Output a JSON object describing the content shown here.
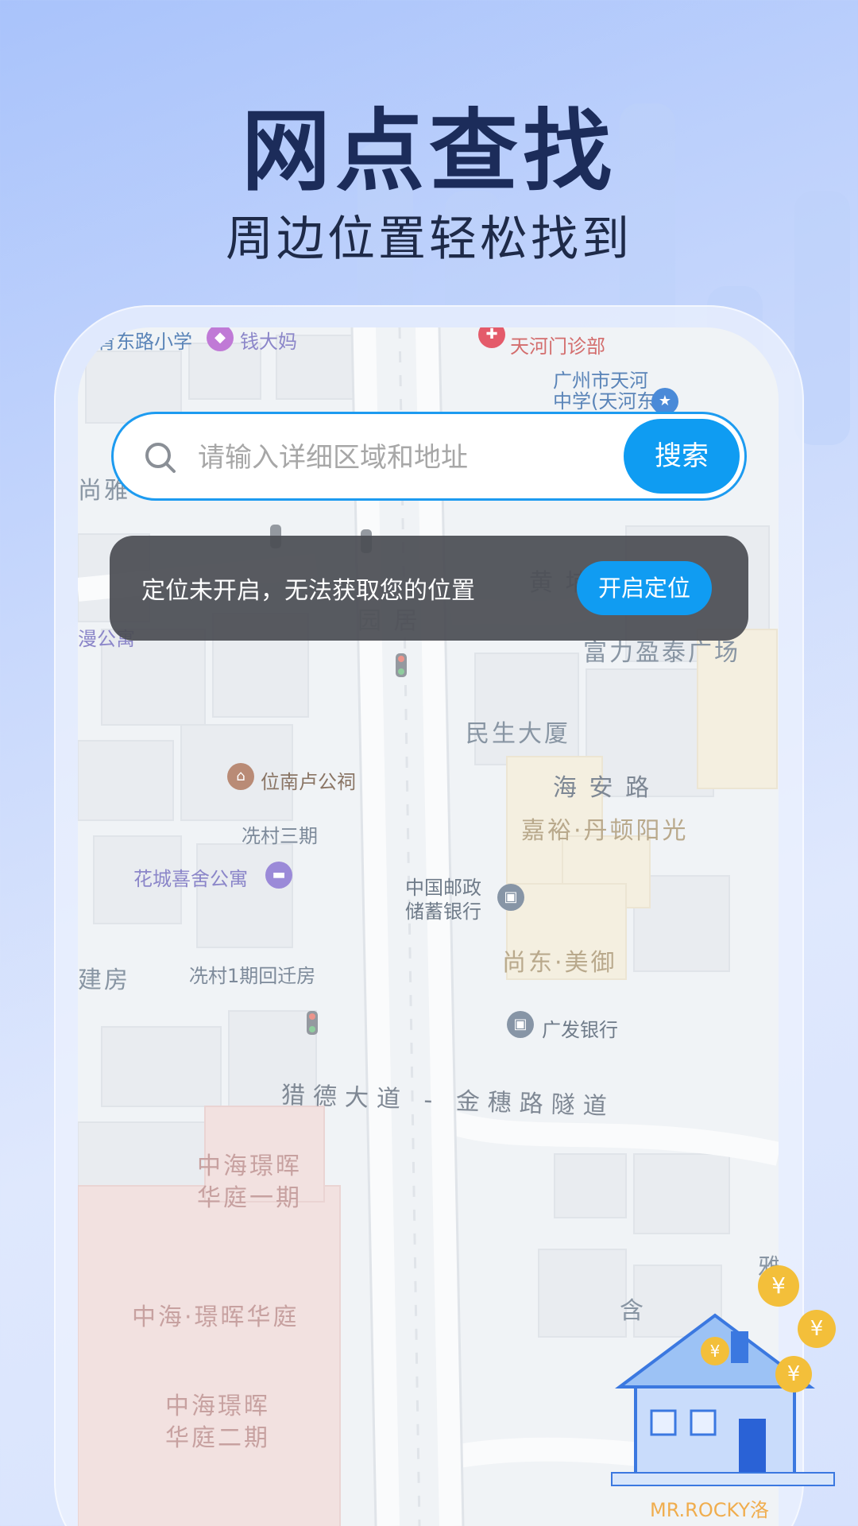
{
  "header": {
    "title": "网点查找",
    "subtitle": "周边位置轻松找到"
  },
  "search": {
    "placeholder": "请输入详细区域和地址",
    "button_label": "搜索",
    "icon": "search-icon"
  },
  "location_notice": {
    "message": "定位未开启，无法获取您的位置",
    "button_label": "开启定位"
  },
  "map": {
    "labels": {
      "school": "体育东路小学",
      "shop": "钱大妈",
      "clinic": "天河门诊部",
      "middle_school": "广州市天河\n中学(天河东",
      "shang": "尚雅",
      "huangpu": "黄 埔",
      "huangpu_b": "园 居",
      "manpu": "漫公寓",
      "fuli": "富力盈泰广场",
      "minsheng": "民生大厦",
      "haian": "海 安 路",
      "jiayu": "嘉裕·丹顿阳光",
      "weinanlu": "位南卢公祠",
      "xiancun3": "冼村三期",
      "huacheng": "花城喜舍公寓",
      "postal": "中国邮政\n储蓄银行",
      "shangdong": "尚东·美御",
      "jianfang": "建房",
      "xiancun1": "冼村1期回迁房",
      "guangfa": "广发银行",
      "road": "猎德大道 - 金穗路隧道",
      "zhonghai1": "中海璟晖\n华庭一期",
      "zhonghai": "中海·璟晖华庭",
      "zhonghai2": "中海璟晖\n华庭二期",
      "han": "含",
      "ming_top": "雅"
    },
    "colors": {
      "buildings": "#dfe4ea",
      "warm_building": "#efe7d2",
      "pink_building": "#edd2d2",
      "road": "#f7f8f9"
    }
  },
  "watermark": "MR.ROCKY洛",
  "colors": {
    "accent": "#0f9cf2",
    "toast_bg": "#4b4e54",
    "title": "#1c2c5a"
  }
}
